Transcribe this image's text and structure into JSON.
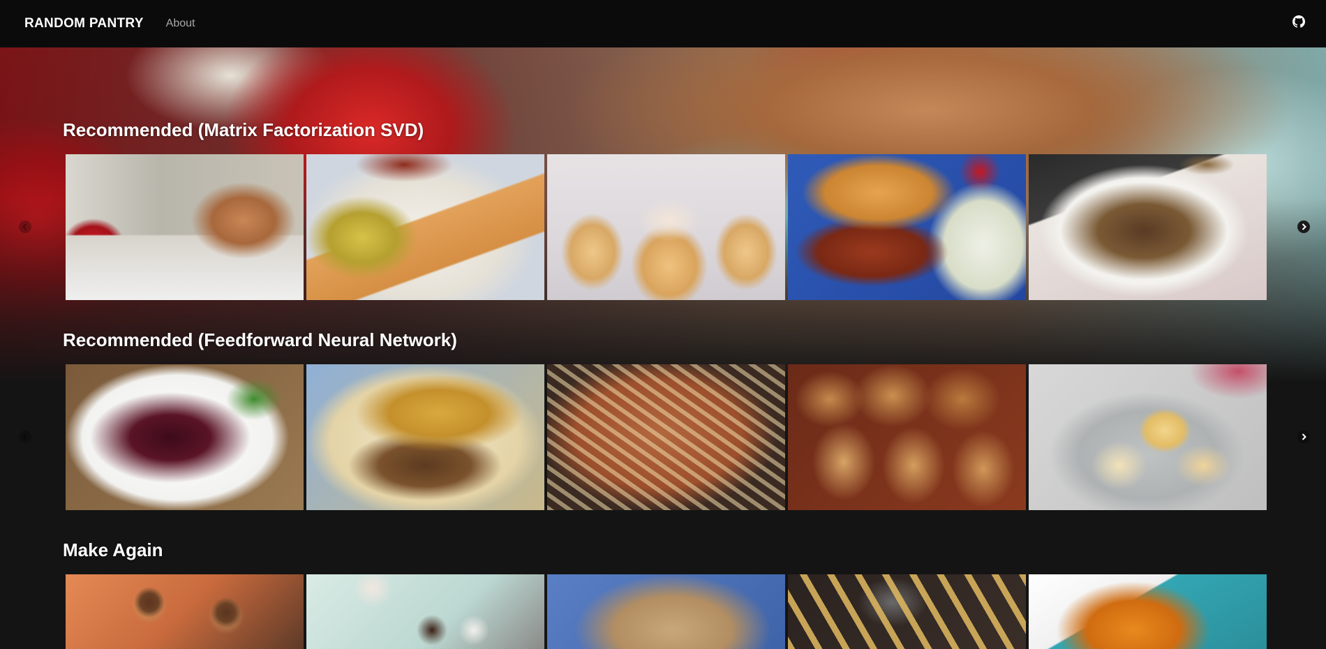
{
  "navbar": {
    "brand": "RANDOM PANTRY",
    "links": [
      {
        "label": "About"
      }
    ],
    "right_icon": "github-icon"
  },
  "rows": [
    {
      "title": "Recommended (Matrix Factorization SVD)",
      "tiles": [
        {
          "subject": "strawberry-muffin"
        },
        {
          "subject": "scrambled-eggs-toast"
        },
        {
          "subject": "vanilla-cupcakes"
        },
        {
          "subject": "pulled-pork-sandwich"
        },
        {
          "subject": "braised-beef"
        }
      ]
    },
    {
      "title": "Recommended (Feedforward Neural Network)",
      "tiles": [
        {
          "subject": "chicken-berry-sauce"
        },
        {
          "subject": "lasagna"
        },
        {
          "subject": "baked-ziti"
        },
        {
          "subject": "breaded-pork-chops"
        },
        {
          "subject": "dinner-rolls"
        }
      ]
    },
    {
      "title": "Make Again",
      "tiles": [
        {
          "subject": "chocolate-cookies"
        },
        {
          "subject": "chocolate-truffles"
        },
        {
          "subject": "oat-bars"
        },
        {
          "subject": "potato-wedges"
        },
        {
          "subject": "glazed-chicken"
        }
      ]
    }
  ],
  "icons": {
    "prev": "chevron-left-icon",
    "next": "chevron-right-icon"
  }
}
